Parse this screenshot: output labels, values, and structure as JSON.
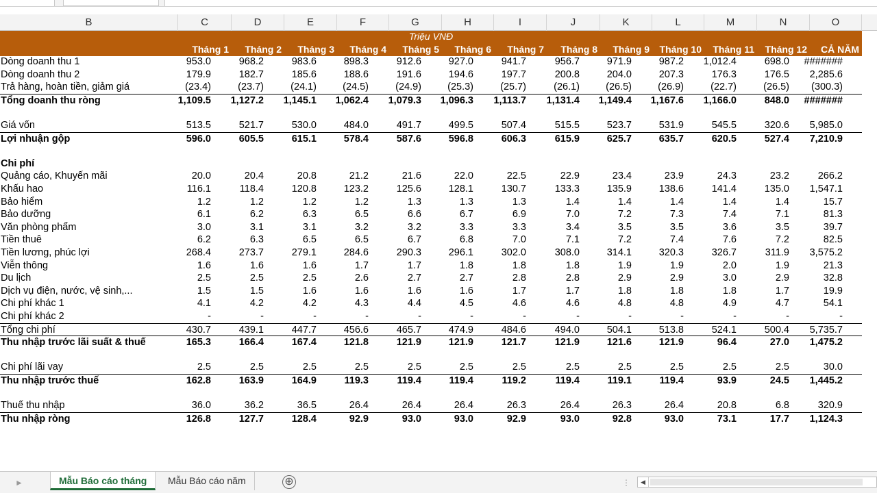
{
  "columns": [
    "B",
    "C",
    "D",
    "E",
    "F",
    "G",
    "H",
    "I",
    "J",
    "K",
    "L",
    "M",
    "N",
    "O"
  ],
  "header": {
    "unit": "Triệu VNĐ",
    "months": [
      "Tháng 1",
      "Tháng 2",
      "Tháng 3",
      "Tháng 4",
      "Tháng 5",
      "Tháng 6",
      "Tháng 7",
      "Tháng 8",
      "Tháng 9",
      "Tháng 10",
      "Tháng 11",
      "Tháng 12",
      "CẢ NĂM"
    ]
  },
  "rows": [
    {
      "label": "Dòng doanh thu 1",
      "values": [
        "953.0",
        "968.2",
        "983.6",
        "898.3",
        "912.6",
        "927.0",
        "941.7",
        "956.7",
        "971.9",
        "987.2",
        "1,012.4",
        "698.0",
        "#######"
      ],
      "bold": false,
      "sep": false
    },
    {
      "label": "Dòng doanh thu 2",
      "values": [
        "179.9",
        "182.7",
        "185.6",
        "188.6",
        "191.6",
        "194.6",
        "197.7",
        "200.8",
        "204.0",
        "207.3",
        "176.3",
        "176.5",
        "2,285.6"
      ],
      "bold": false,
      "sep": false
    },
    {
      "label": "Trả hàng, hoàn tiền, giảm giá",
      "values": [
        "(23.4)",
        "(23.7)",
        "(24.1)",
        "(24.5)",
        "(24.9)",
        "(25.3)",
        "(25.7)",
        "(26.1)",
        "(26.5)",
        "(26.9)",
        "(22.7)",
        "(26.5)",
        "(300.3)"
      ],
      "bold": false,
      "sep": false
    },
    {
      "label": "Tổng doanh thu ròng",
      "values": [
        "1,109.5",
        "1,127.2",
        "1,145.1",
        "1,062.4",
        "1,079.3",
        "1,096.3",
        "1,113.7",
        "1,131.4",
        "1,149.4",
        "1,167.6",
        "1,166.0",
        "848.0",
        "#######"
      ],
      "bold": true,
      "sep": true
    },
    {
      "label": "",
      "values": [
        "",
        "",
        "",
        "",
        "",
        "",
        "",
        "",
        "",
        "",
        "",
        "",
        ""
      ],
      "bold": false,
      "sep": false
    },
    {
      "label": "Giá vốn",
      "values": [
        "513.5",
        "521.7",
        "530.0",
        "484.0",
        "491.7",
        "499.5",
        "507.4",
        "515.5",
        "523.7",
        "531.9",
        "545.5",
        "320.6",
        "5,985.0"
      ],
      "bold": false,
      "sep": false
    },
    {
      "label": "Lợi nhuận gộp",
      "values": [
        "596.0",
        "605.5",
        "615.1",
        "578.4",
        "587.6",
        "596.8",
        "606.3",
        "615.9",
        "625.7",
        "635.7",
        "620.5",
        "527.4",
        "7,210.9"
      ],
      "bold": true,
      "sep": true
    },
    {
      "label": "",
      "values": [
        "",
        "",
        "",
        "",
        "",
        "",
        "",
        "",
        "",
        "",
        "",
        "",
        ""
      ],
      "bold": false,
      "sep": false
    },
    {
      "label": "Chi phí",
      "values": [
        "",
        "",
        "",
        "",
        "",
        "",
        "",
        "",
        "",
        "",
        "",
        "",
        ""
      ],
      "bold": true,
      "sep": false
    },
    {
      "label": "Quảng cáo, Khuyến mãi",
      "values": [
        "20.0",
        "20.4",
        "20.8",
        "21.2",
        "21.6",
        "22.0",
        "22.5",
        "22.9",
        "23.4",
        "23.9",
        "24.3",
        "23.2",
        "266.2"
      ],
      "bold": false,
      "sep": false
    },
    {
      "label": "Khấu hao",
      "values": [
        "116.1",
        "118.4",
        "120.8",
        "123.2",
        "125.6",
        "128.1",
        "130.7",
        "133.3",
        "135.9",
        "138.6",
        "141.4",
        "135.0",
        "1,547.1"
      ],
      "bold": false,
      "sep": false
    },
    {
      "label": "Bảo hiểm",
      "values": [
        "1.2",
        "1.2",
        "1.2",
        "1.2",
        "1.3",
        "1.3",
        "1.3",
        "1.4",
        "1.4",
        "1.4",
        "1.4",
        "1.4",
        "15.7"
      ],
      "bold": false,
      "sep": false
    },
    {
      "label": "Bảo dưỡng",
      "values": [
        "6.1",
        "6.2",
        "6.3",
        "6.5",
        "6.6",
        "6.7",
        "6.9",
        "7.0",
        "7.2",
        "7.3",
        "7.4",
        "7.1",
        "81.3"
      ],
      "bold": false,
      "sep": false
    },
    {
      "label": "Văn phòng phẩm",
      "values": [
        "3.0",
        "3.1",
        "3.1",
        "3.2",
        "3.2",
        "3.3",
        "3.3",
        "3.4",
        "3.5",
        "3.5",
        "3.6",
        "3.5",
        "39.7"
      ],
      "bold": false,
      "sep": false
    },
    {
      "label": "Tiền thuê",
      "values": [
        "6.2",
        "6.3",
        "6.5",
        "6.5",
        "6.7",
        "6.8",
        "7.0",
        "7.1",
        "7.2",
        "7.4",
        "7.6",
        "7.2",
        "82.5"
      ],
      "bold": false,
      "sep": false
    },
    {
      "label": "Tiền lương, phúc lợi",
      "values": [
        "268.4",
        "273.7",
        "279.1",
        "284.6",
        "290.3",
        "296.1",
        "302.0",
        "308.0",
        "314.1",
        "320.3",
        "326.7",
        "311.9",
        "3,575.2"
      ],
      "bold": false,
      "sep": false
    },
    {
      "label": "Viễn thông",
      "values": [
        "1.6",
        "1.6",
        "1.6",
        "1.7",
        "1.7",
        "1.8",
        "1.8",
        "1.8",
        "1.9",
        "1.9",
        "2.0",
        "1.9",
        "21.3"
      ],
      "bold": false,
      "sep": false
    },
    {
      "label": "Du lịch",
      "values": [
        "2.5",
        "2.5",
        "2.5",
        "2.6",
        "2.7",
        "2.7",
        "2.8",
        "2.8",
        "2.9",
        "2.9",
        "3.0",
        "2.9",
        "32.8"
      ],
      "bold": false,
      "sep": false
    },
    {
      "label": "Dịch vụ điện, nước, vệ sinh,...",
      "values": [
        "1.5",
        "1.5",
        "1.6",
        "1.6",
        "1.6",
        "1.6",
        "1.7",
        "1.7",
        "1.8",
        "1.8",
        "1.8",
        "1.7",
        "19.9"
      ],
      "bold": false,
      "sep": false
    },
    {
      "label": "Chi phí khác 1",
      "values": [
        "4.1",
        "4.2",
        "4.2",
        "4.3",
        "4.4",
        "4.5",
        "4.6",
        "4.6",
        "4.8",
        "4.8",
        "4.9",
        "4.7",
        "54.1"
      ],
      "bold": false,
      "sep": false
    },
    {
      "label": "Chi phí khác 2",
      "values": [
        "-",
        "-",
        "-",
        "-",
        "-",
        "-",
        "-",
        "-",
        "-",
        "-",
        "-",
        "-",
        "-"
      ],
      "bold": false,
      "sep": false
    },
    {
      "label": "Tổng chi phí",
      "values": [
        "430.7",
        "439.1",
        "447.7",
        "456.6",
        "465.7",
        "474.9",
        "484.6",
        "494.0",
        "504.1",
        "513.8",
        "524.1",
        "500.4",
        "5,735.7"
      ],
      "bold": false,
      "sep": true
    },
    {
      "label": "Thu nhập trước lãi suất & thuế",
      "values": [
        "165.3",
        "166.4",
        "167.4",
        "121.8",
        "121.9",
        "121.9",
        "121.7",
        "121.9",
        "121.6",
        "121.9",
        "96.4",
        "27.0",
        "1,475.2"
      ],
      "bold": true,
      "sep": true
    },
    {
      "label": "",
      "values": [
        "",
        "",
        "",
        "",
        "",
        "",
        "",
        "",
        "",
        "",
        "",
        "",
        ""
      ],
      "bold": false,
      "sep": false
    },
    {
      "label": "Chi phí lãi vay",
      "values": [
        "2.5",
        "2.5",
        "2.5",
        "2.5",
        "2.5",
        "2.5",
        "2.5",
        "2.5",
        "2.5",
        "2.5",
        "2.5",
        "2.5",
        "30.0"
      ],
      "bold": false,
      "sep": false
    },
    {
      "label": "Thu nhập trước thuế",
      "values": [
        "162.8",
        "163.9",
        "164.9",
        "119.3",
        "119.4",
        "119.4",
        "119.2",
        "119.4",
        "119.1",
        "119.4",
        "93.9",
        "24.5",
        "1,445.2"
      ],
      "bold": true,
      "sep": true
    },
    {
      "label": "",
      "values": [
        "",
        "",
        "",
        "",
        "",
        "",
        "",
        "",
        "",
        "",
        "",
        "",
        ""
      ],
      "bold": false,
      "sep": false
    },
    {
      "label": "Thuế thu nhập",
      "values": [
        "36.0",
        "36.2",
        "36.5",
        "26.4",
        "26.4",
        "26.4",
        "26.3",
        "26.4",
        "26.3",
        "26.4",
        "20.8",
        "6.8",
        "320.9"
      ],
      "bold": false,
      "sep": false
    },
    {
      "label": "Thu nhập ròng",
      "values": [
        "126.8",
        "127.7",
        "128.4",
        "92.9",
        "93.0",
        "93.0",
        "92.9",
        "93.0",
        "92.8",
        "93.0",
        "73.1",
        "17.7",
        "1,124.3"
      ],
      "bold": true,
      "sep": true
    }
  ],
  "tabs": {
    "active": "Mẫu Báo cáo tháng",
    "inactive": "Mẫu Báo cáo năm",
    "add_symbol": "⊕"
  },
  "colors": {
    "band": "#b75d0b",
    "active_tab": "#1e6b37"
  }
}
